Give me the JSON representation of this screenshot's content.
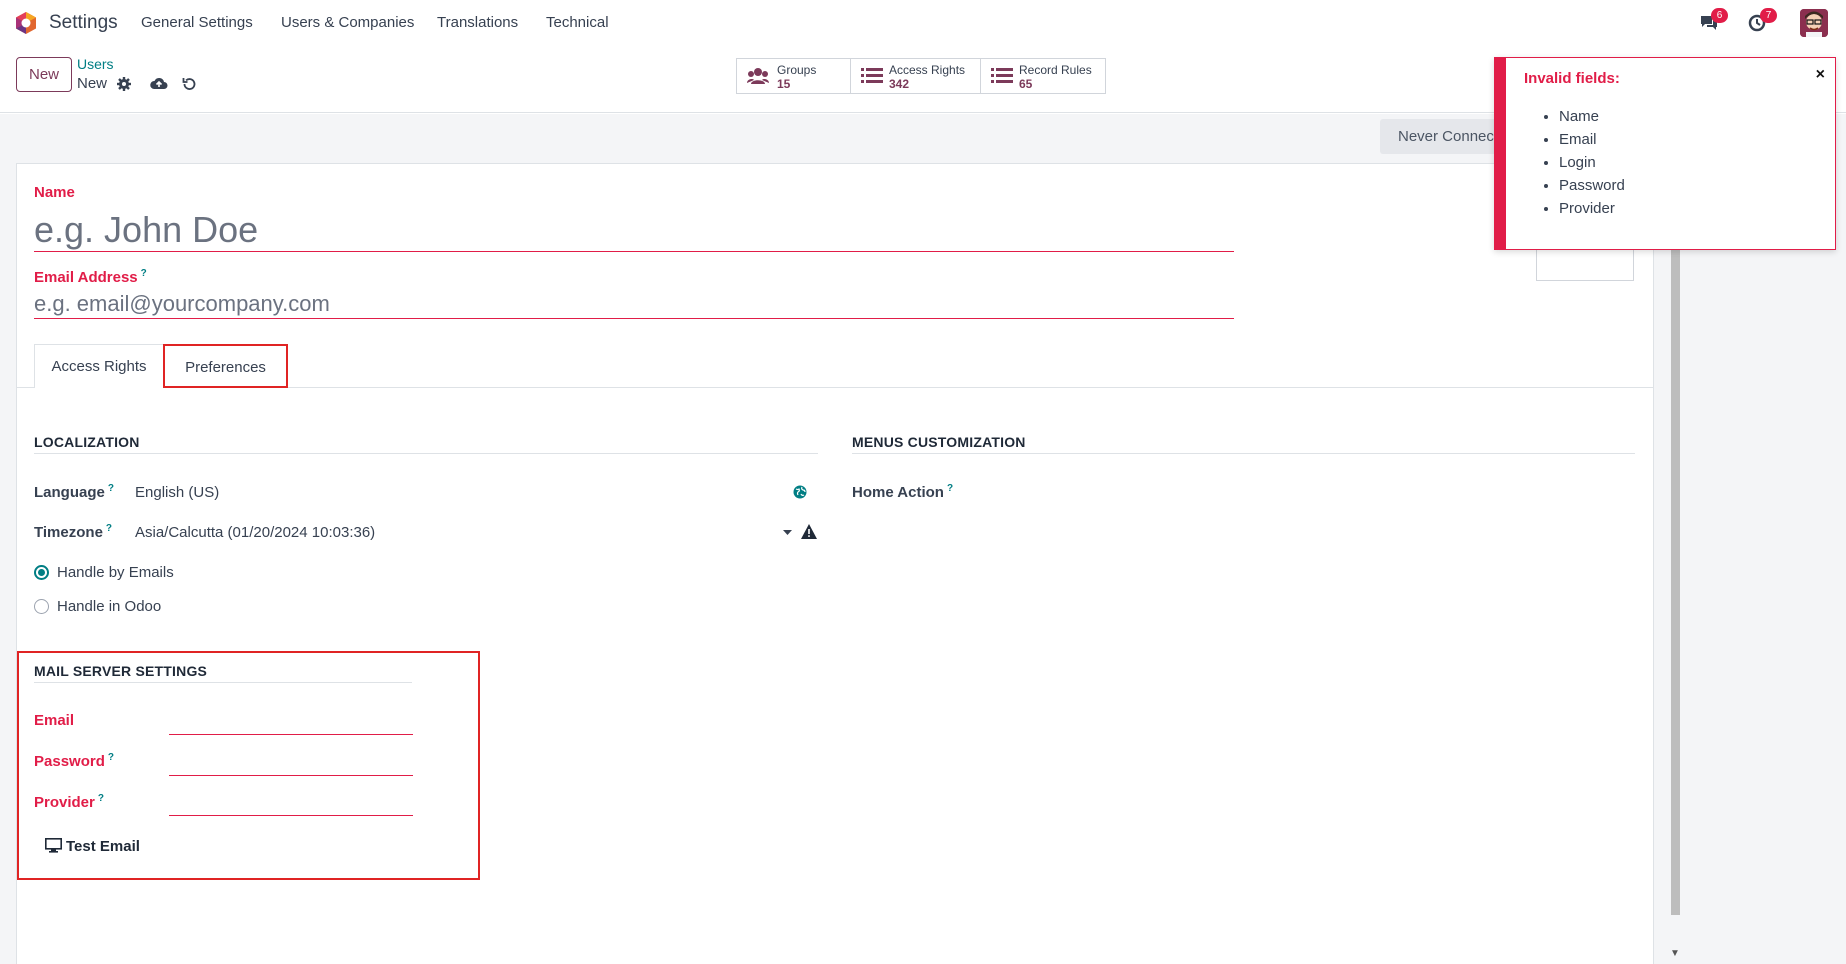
{
  "app": {
    "title": "Settings"
  },
  "menu": [
    "General Settings",
    "Users & Companies",
    "Translations",
    "Technical"
  ],
  "systray": {
    "messages_count": "6",
    "activities_count": "7"
  },
  "control_panel": {
    "new_label": "New",
    "breadcrumb_parent": "Users",
    "breadcrumb_current": "New",
    "smart_buttons": [
      {
        "label": "Groups",
        "value": "15"
      },
      {
        "label": "Access Rights",
        "value": "342"
      },
      {
        "label": "Record Rules",
        "value": "65"
      }
    ]
  },
  "status_button": "Never Connected",
  "form": {
    "name_label": "Name",
    "name_placeholder": "e.g. John Doe",
    "email_label": "Email Address",
    "email_placeholder": "e.g. email@yourcompany.com",
    "help_mark": "?"
  },
  "tabs": [
    {
      "label": "Access Rights",
      "active": false
    },
    {
      "label": "Preferences",
      "active": true
    }
  ],
  "localization": {
    "title": "LOCALIZATION",
    "language_label": "Language",
    "language_value": "English (US)",
    "timezone_label": "Timezone",
    "timezone_value": "Asia/Calcutta (01/20/2024 10:03:36)",
    "notification_options": [
      {
        "label": "Handle by Emails",
        "selected": true
      },
      {
        "label": "Handle in Odoo",
        "selected": false
      }
    ]
  },
  "menus_customization": {
    "title": "MENUS CUSTOMIZATION",
    "home_action_label": "Home Action"
  },
  "mail_server": {
    "title": "MAIL SERVER SETTINGS",
    "email_label": "Email",
    "password_label": "Password",
    "provider_label": "Provider",
    "test_button": "Test Email"
  },
  "notification": {
    "title": "Invalid fields:",
    "close": "×",
    "items": [
      "Name",
      "Email",
      "Login",
      "Password",
      "Provider"
    ]
  },
  "colors": {
    "brand": "#7c3a5a",
    "accent": "#017e84",
    "danger": "#e11d48"
  }
}
